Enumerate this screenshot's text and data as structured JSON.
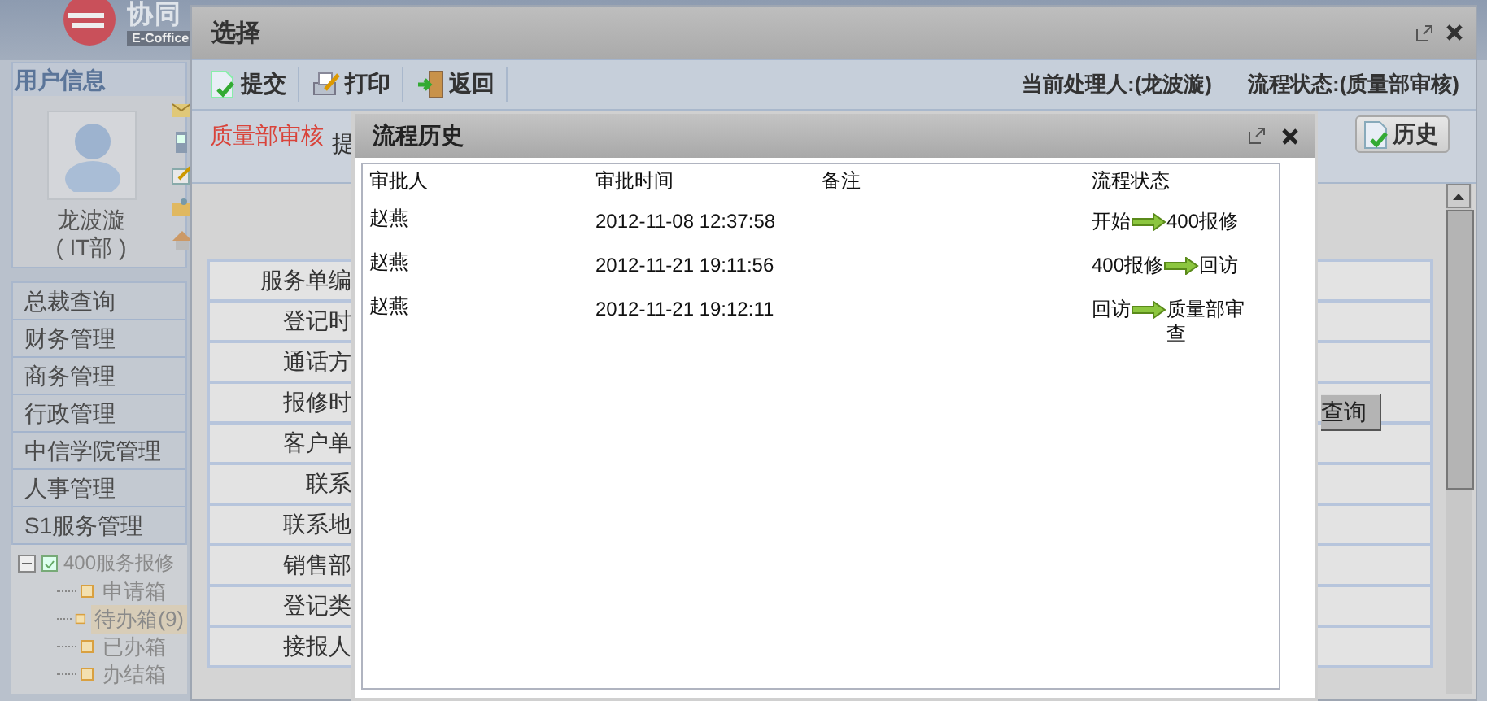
{
  "app": {
    "logo_text": "协同",
    "logo_subtext": "E-Coffice",
    "user_panel": {
      "title": "用户信息",
      "name": "龙波漩",
      "department": "( IT部 )"
    },
    "menu": [
      {
        "label": "总裁查询"
      },
      {
        "label": "财务管理"
      },
      {
        "label": "商务管理"
      },
      {
        "label": "行政管理"
      },
      {
        "label": "中信学院管理"
      },
      {
        "label": "人事管理"
      },
      {
        "label": "S1服务管理"
      }
    ],
    "tree": {
      "label": "400服务报修",
      "expanded": true,
      "children": [
        {
          "label": "申请箱",
          "selected": false
        },
        {
          "label": "待办箱(9)",
          "selected": true
        },
        {
          "label": "已办箱",
          "selected": false
        },
        {
          "label": "办结箱",
          "selected": false
        }
      ]
    }
  },
  "select_window": {
    "title": "选择",
    "toolbar": [
      {
        "kind": "submit",
        "label": "提交"
      },
      {
        "kind": "print",
        "label": "打印"
      },
      {
        "kind": "back",
        "label": "返回"
      }
    ],
    "current_handler": "当前处理人:(龙波漩)",
    "flow_status": "流程状态:(质量部审核)",
    "stage": "质量部审核",
    "stage_note": "提",
    "history_button": "历史",
    "query_button": "查询",
    "form_labels": [
      "服务单编",
      "登记时",
      "通话方",
      "报修时",
      "客户单",
      "联系",
      "联系地",
      "销售部",
      "登记类",
      "接报人"
    ]
  },
  "history_dialog": {
    "title": "流程历史",
    "columns": [
      "审批人",
      "审批时间",
      "备注",
      "流程状态"
    ],
    "rows": [
      {
        "approver": "赵燕",
        "time": "2012-11-08 12:37:58",
        "steps": [
          "开始",
          "400报修"
        ]
      },
      {
        "approver": "赵燕",
        "time": "2012-11-21 19:11:56",
        "steps": [
          "400报修",
          "回访"
        ]
      },
      {
        "approver": "赵燕",
        "time": "2012-11-21 19:12:11",
        "steps": [
          "回访",
          "质量部审查"
        ]
      }
    ]
  }
}
